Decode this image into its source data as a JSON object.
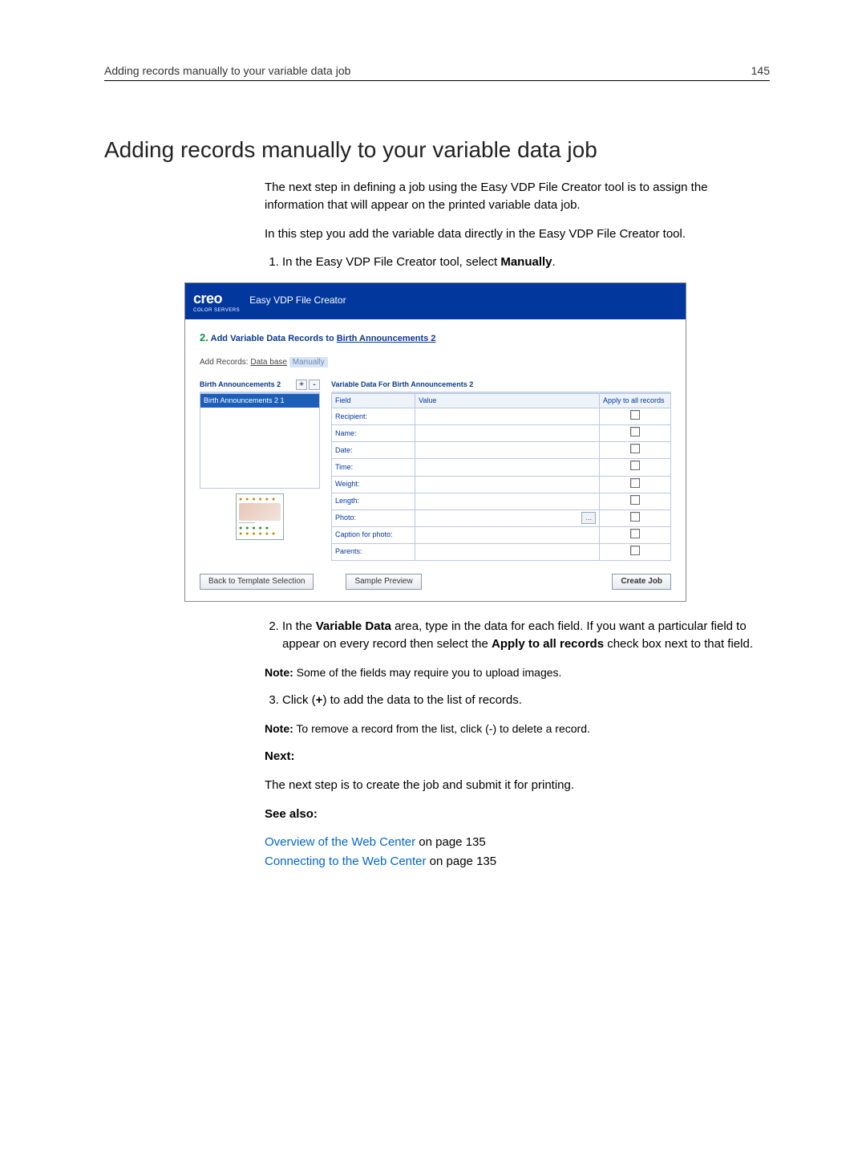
{
  "header": {
    "running_title": "Adding records manually to your variable data job",
    "page_number": "145"
  },
  "title": "Adding records manually to your variable data job",
  "paragraphs": {
    "intro1": "The next step in defining a job using the Easy VDP File Creator tool is to assign the information that will appear on the printed variable data job.",
    "intro2": "In this step you add the variable data directly in the Easy VDP File Creator tool."
  },
  "steps": {
    "s1_pre": "In the Easy VDP File Creator tool, select ",
    "s1_bold": "Manually",
    "s1_post": ".",
    "s2_pre": "In the ",
    "s2_b1": "Variable Data",
    "s2_mid": " area, type in the data for each field. If you want a particular field to appear on every record then select the ",
    "s2_b2": "Apply to all records",
    "s2_post": " check box next to that field.",
    "note1_pre": "Note:",
    "note1_text": " Some of the fields may require you to upload images.",
    "s3_pre": "Click (",
    "s3_b": "+",
    "s3_post": ") to add the data to the list of records.",
    "note2_pre": "Note:",
    "note2_text": " To remove a record from the list, click (-) to delete a record."
  },
  "next": {
    "heading": "Next:",
    "text": "The next step is to create the job and submit it for printing."
  },
  "see_also": {
    "heading": "See also:",
    "l1_text": "Overview of the Web Center",
    "l1_suffix": " on page 135",
    "l2_text": "Connecting to the Web Center",
    "l2_suffix": " on page 135"
  },
  "screenshot": {
    "logo": "creo",
    "logo_sub": "COLOR SERVERS",
    "app_title": "Easy VDP File Creator",
    "step_num": "2.",
    "step_text_pre": "Add Variable Data Records to ",
    "step_link": "Birth Announcements 2",
    "add_records_label": "Add Records:",
    "add_records_db": "Data base",
    "add_records_manual": "Manually",
    "left_heading": "Birth Announcements 2",
    "plus": "+",
    "minus": "-",
    "list_item": "Birth Announcements 2 1",
    "right_heading": "Variable Data For Birth Announcements 2",
    "col_field": "Field",
    "col_value": "Value",
    "col_apply": "Apply to all records",
    "fields": [
      "Recipient:",
      "Name:",
      "Date:",
      "Time:",
      "Weight:",
      "Length:",
      "Photo:",
      "Caption for photo:",
      "Parents:"
    ],
    "dots": "...",
    "btn_back": "Back to Template Selection",
    "btn_sample": "Sample Preview",
    "btn_create": "Create Job"
  }
}
